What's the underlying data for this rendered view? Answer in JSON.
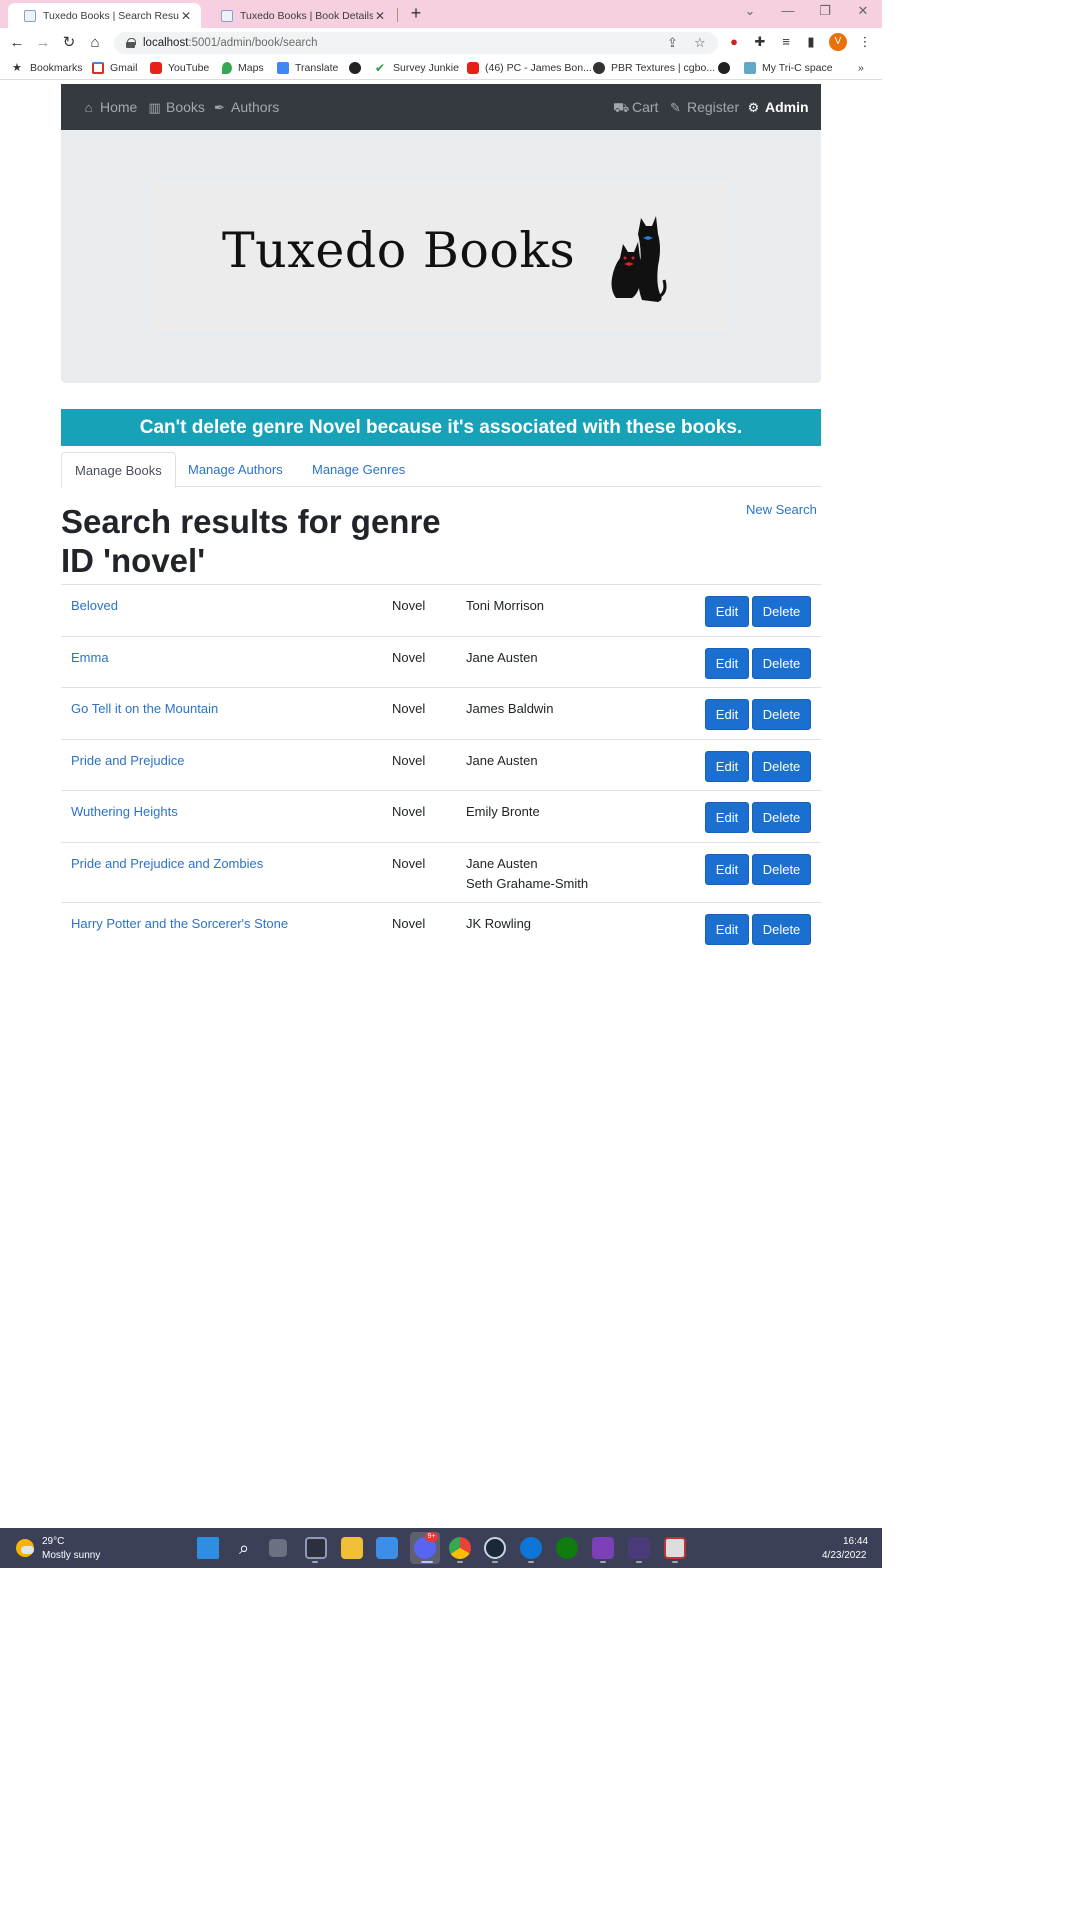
{
  "browser": {
    "tabs": [
      {
        "title": "Tuxedo Books | Search Results",
        "active": true
      },
      {
        "title": "Tuxedo Books | Book Details",
        "active": false
      }
    ],
    "address": {
      "host": "localhost",
      "path": ":5001/admin/book/search"
    },
    "bookmarks": [
      {
        "label": "Bookmarks",
        "icon": "star-icon"
      },
      {
        "label": "Gmail",
        "icon": "gmail-icon"
      },
      {
        "label": "YouTube",
        "icon": "youtube-icon"
      },
      {
        "label": "Maps",
        "icon": "maps-icon"
      },
      {
        "label": "Translate",
        "icon": "translate-icon"
      },
      {
        "label": "",
        "icon": "globe-icon"
      },
      {
        "label": "Survey Junkie",
        "icon": "survey-junkie-icon"
      },
      {
        "label": "(46) PC - James Bon...",
        "icon": "youtube-icon"
      },
      {
        "label": "PBR Textures | cgbo...",
        "icon": "palette-icon"
      },
      {
        "label": "",
        "icon": "globe-icon"
      },
      {
        "label": "My Tri-C space",
        "icon": "tric-icon"
      }
    ],
    "profile_initial": "V",
    "profile_color": "#e8710a"
  },
  "navbar": {
    "home": "Home",
    "books": "Books",
    "authors": "Authors",
    "cart": "Cart",
    "register": "Register",
    "admin": "Admin"
  },
  "logo": {
    "text": "Tuxedo Books"
  },
  "alert": {
    "message": "Can't delete genre Novel because it's associated with these books.",
    "color": "#17a2b8"
  },
  "tabs": [
    {
      "label": "Manage Books",
      "active": true
    },
    {
      "label": "Manage Authors",
      "active": false
    },
    {
      "label": "Manage Genres",
      "active": false
    }
  ],
  "heading": {
    "line1": "Search results for genre",
    "line2": "ID 'novel'"
  },
  "new_search": "New Search",
  "buttons": {
    "edit": "Edit",
    "delete": "Delete"
  },
  "books": [
    {
      "title": "Beloved",
      "genre": "Novel",
      "authors": [
        "Toni Morrison"
      ]
    },
    {
      "title": "Emma",
      "genre": "Novel",
      "authors": [
        "Jane Austen"
      ]
    },
    {
      "title": "Go Tell it on the Mountain",
      "genre": "Novel",
      "authors": [
        "James Baldwin"
      ]
    },
    {
      "title": "Pride and Prejudice",
      "genre": "Novel",
      "authors": [
        "Jane Austen"
      ]
    },
    {
      "title": "Wuthering Heights",
      "genre": "Novel",
      "authors": [
        "Emily Bronte"
      ]
    },
    {
      "title": "Pride and Prejudice and Zombies",
      "genre": "Novel",
      "authors": [
        "Jane Austen",
        "Seth Grahame-Smith"
      ]
    },
    {
      "title": "Harry Potter and the Sorcerer's Stone",
      "genre": "Novel",
      "authors": [
        "JK Rowling"
      ]
    }
  ],
  "colors": {
    "link": "#2c73c9",
    "button": "#1a6fd0",
    "navbar": "#343a40",
    "tabbar": "#f6cfe0"
  },
  "taskbar": {
    "temperature": "29°C",
    "weather": "Mostly sunny",
    "time": "16:44",
    "date": "4/23/2022",
    "discord_badge": "9+"
  }
}
